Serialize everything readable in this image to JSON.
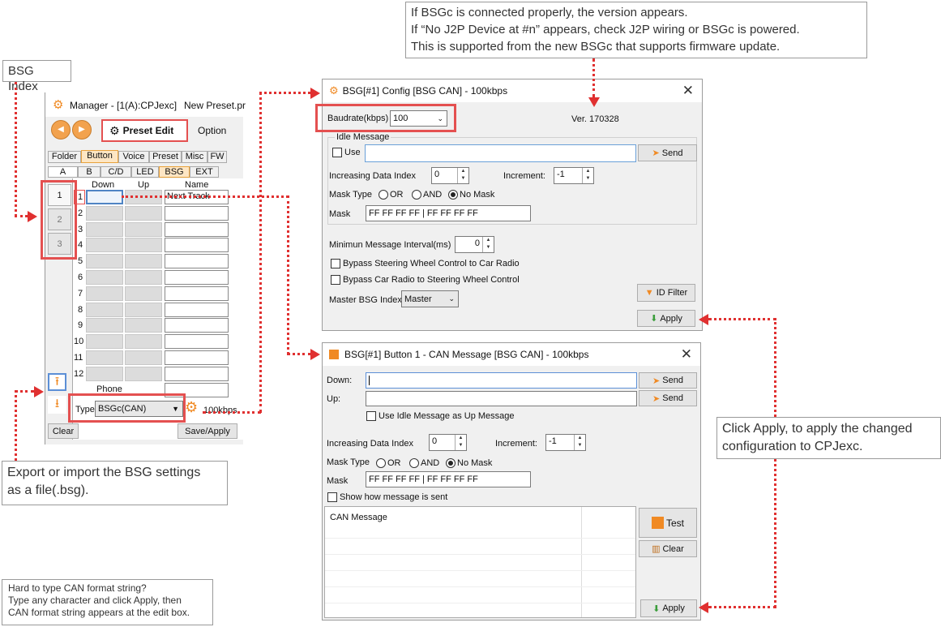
{
  "notes": {
    "bsg_index": "BSG Index",
    "version_lines": [
      "If BSGc is connected properly, the version appears.",
      "If “No J2P Device at #n” appears, check J2P wiring or BSGc is powered.",
      "This is supported from the new BSGc that supports firmware update."
    ],
    "apply_lines": [
      "Click Apply, to apply the changed",
      "configuration to CPJexc."
    ],
    "export_lines": [
      "Export or import the BSG settings",
      "as a file(.bsg)."
    ],
    "hint_lines": [
      "Hard to type CAN format string?",
      "Type any character and click Apply, then",
      "CAN format string appears at the edit box."
    ]
  },
  "manager": {
    "title": "Manager - [1(A):CPJexc]",
    "preset_name": "New Preset.pr",
    "preset_edit": "Preset Edit",
    "option": "Option",
    "top_tabs": [
      "Folder",
      "Button",
      "Voice",
      "Preset",
      "Misc",
      "FW"
    ],
    "sub_tabs": [
      "A",
      "B",
      "C/D",
      "LED",
      "BSG",
      "EXT"
    ],
    "bsg_indexes": [
      "1",
      "2",
      "3"
    ],
    "columns": {
      "down": "Down",
      "up": "Up",
      "name": "Name"
    },
    "rows": [
      "1",
      "2",
      "3",
      "4",
      "5",
      "6",
      "7",
      "8",
      "9",
      "10",
      "11",
      "12"
    ],
    "row1_name": "Next Track",
    "phone_label": "Phone",
    "type_label": "Type",
    "type_value": "BSGc(CAN)",
    "speed": "100kbps",
    "clear": "Clear",
    "save_apply": "Save/Apply"
  },
  "config": {
    "title": "BSG[#1] Config [BSG CAN] - 100kbps",
    "baudrate_label": "Baudrate(kbps)",
    "baudrate_value": "100",
    "version": "Ver. 170328",
    "idle_group": "Idle Message",
    "use_label": "Use",
    "send": "Send",
    "inc_label": "Increasing Data Index",
    "inc_value": "0",
    "increment_label": "Increment:",
    "increment_value": "-1",
    "masktype_label": "Mask Type",
    "mask_or": "OR",
    "mask_and": "AND",
    "mask_none": "No Mask",
    "mask_label": "Mask",
    "mask_value": "FF FF FF FF | FF FF FF FF",
    "min_interval_label": "Minimun Message Interval(ms)",
    "min_interval_value": "0",
    "bypass1": "Bypass Steering Wheel Control to Car Radio",
    "bypass2": "Bypass Car Radio to Steering Wheel Control",
    "id_filter": "ID Filter",
    "master_label": "Master BSG Index",
    "master_value": "Master",
    "apply": "Apply"
  },
  "button": {
    "title": "BSG[#1] Button 1 - CAN Message [BSG CAN] - 100kbps",
    "down_label": "Down:",
    "up_label": "Up:",
    "send": "Send",
    "use_idle": "Use Idle Message as Up Message",
    "inc_label": "Increasing Data Index",
    "inc_value": "0",
    "increment_label": "Increment:",
    "increment_value": "-1",
    "masktype_label": "Mask Type",
    "mask_or": "OR",
    "mask_and": "AND",
    "mask_none": "No Mask",
    "mask_label": "Mask",
    "mask_value": "FF FF FF FF | FF FF FF FF",
    "show_how": "Show how message is sent",
    "can_message": "CAN Message",
    "test": "Test",
    "clear": "Clear",
    "apply": "Apply"
  },
  "colors": {
    "accent_red": "#e45050",
    "dotted": "#e03030",
    "orange": "#f08a24"
  }
}
